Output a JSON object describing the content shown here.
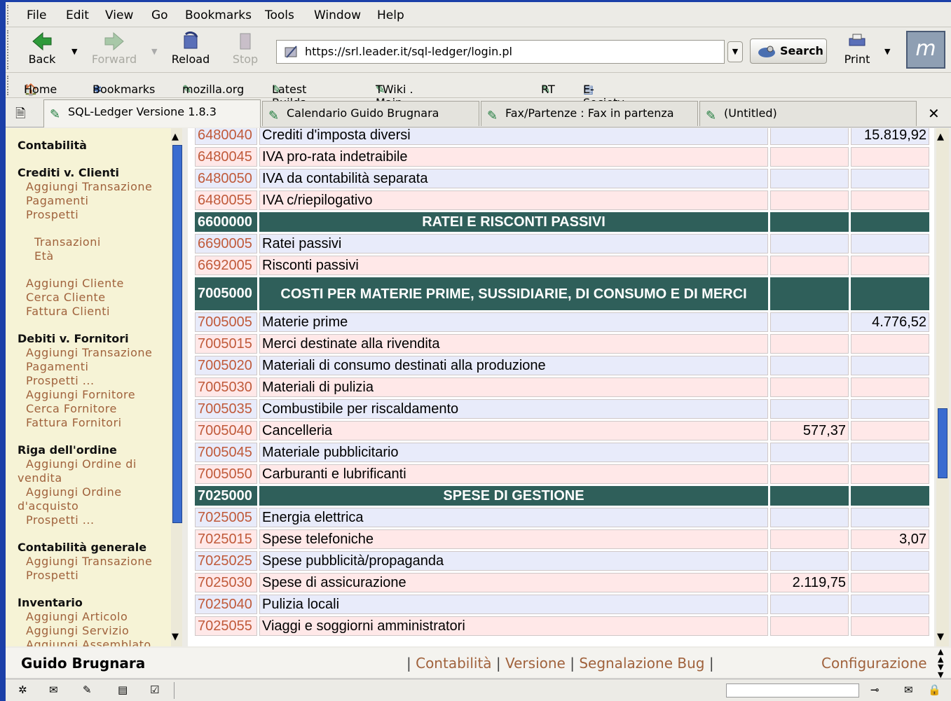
{
  "menu": [
    "File",
    "Edit",
    "View",
    "Go",
    "Bookmarks",
    "Tools",
    "Window",
    "Help"
  ],
  "nav": {
    "back": "Back",
    "forward": "Forward",
    "reload": "Reload",
    "stop": "Stop",
    "print": "Print",
    "search": "Search",
    "url": "https://srl.leader.it/sql-ledger/login.pl"
  },
  "bookmarks": [
    "Home",
    "Bookmarks",
    "mozilla.org",
    "Latest Builds",
    "TWiki . Main . WebHo...",
    "RT",
    "E-Society"
  ],
  "tabs": [
    "SQL-Ledger Versione 1.8.3",
    "Calendario Guido Brugnara",
    "Fax/Partenze : Fax in partenza",
    "(Untitled)"
  ],
  "sidebar": {
    "contabilita": "Contabilità",
    "crediti": {
      "title": "Crediti v. Clienti",
      "items": [
        "Aggiungi Transazione",
        "Pagamenti",
        "Prospetti"
      ],
      "sub": [
        "Transazioni",
        "Età"
      ],
      "more": [
        "Aggiungi Cliente",
        "Cerca Cliente",
        "Fattura Clienti"
      ]
    },
    "debiti": {
      "title": "Debiti v. Fornitori",
      "items": [
        "Aggiungi Transazione",
        "Pagamenti",
        "Prospetti ...",
        "Aggiungi Fornitore",
        "Cerca Fornitore",
        "Fattura Fornitori"
      ]
    },
    "ordine": {
      "title": "Riga dell'ordine",
      "items": [
        "Aggiungi Ordine di vendita",
        "Aggiungi Ordine d'acquisto",
        "Prospetti ..."
      ]
    },
    "generale": {
      "title": "Contabilità generale",
      "items": [
        "Aggiungi Transazione",
        "Prospetti"
      ]
    },
    "inventario": {
      "title": "Inventario",
      "items": [
        "Aggiungi Articolo",
        "Aggiungi Servizio",
        "Aggiungi Assemblato"
      ]
    }
  },
  "rows": [
    {
      "code": "6480040",
      "desc": "Crediti d'imposta diversi",
      "a": "",
      "b": "15.819,92",
      "type": "blue"
    },
    {
      "code": "6480045",
      "desc": "IVA pro-rata indetraibile",
      "a": "",
      "b": "",
      "type": "pink"
    },
    {
      "code": "6480050",
      "desc": "IVA da contabilità separata",
      "a": "",
      "b": "",
      "type": "blue"
    },
    {
      "code": "6480055",
      "desc": "IVA c/riepilogativo",
      "a": "",
      "b": "",
      "type": "pink"
    },
    {
      "code": "6600000",
      "desc": "RATEI E RISCONTI PASSIVI",
      "a": "",
      "b": "",
      "type": "head"
    },
    {
      "code": "6690005",
      "desc": "Ratei passivi",
      "a": "",
      "b": "",
      "type": "blue"
    },
    {
      "code": "6692005",
      "desc": "Risconti passivi",
      "a": "",
      "b": "",
      "type": "pink"
    },
    {
      "code": "7005000",
      "desc": "COSTI PER MATERIE PRIME, SUSSIDIARIE, DI CONSUMO E DI MERCI",
      "a": "",
      "b": "",
      "type": "head2"
    },
    {
      "code": "7005005",
      "desc": "Materie prime",
      "a": "",
      "b": "4.776,52",
      "type": "blue"
    },
    {
      "code": "7005015",
      "desc": "Merci destinate alla rivendita",
      "a": "",
      "b": "",
      "type": "pink"
    },
    {
      "code": "7005020",
      "desc": "Materiali di consumo destinati alla produzione",
      "a": "",
      "b": "",
      "type": "blue"
    },
    {
      "code": "7005030",
      "desc": "Materiali di pulizia",
      "a": "",
      "b": "",
      "type": "pink"
    },
    {
      "code": "7005035",
      "desc": "Combustibile per riscaldamento",
      "a": "",
      "b": "",
      "type": "blue"
    },
    {
      "code": "7005040",
      "desc": "Cancelleria",
      "a": "577,37",
      "b": "",
      "type": "pink"
    },
    {
      "code": "7005045",
      "desc": "Materiale pubblicitario",
      "a": "",
      "b": "",
      "type": "blue"
    },
    {
      "code": "7005050",
      "desc": "Carburanti e lubrificanti",
      "a": "",
      "b": "",
      "type": "pink"
    },
    {
      "code": "7025000",
      "desc": "SPESE DI GESTIONE",
      "a": "",
      "b": "",
      "type": "head"
    },
    {
      "code": "7025005",
      "desc": "Energia elettrica",
      "a": "",
      "b": "",
      "type": "blue"
    },
    {
      "code": "7025015",
      "desc": "Spese telefoniche",
      "a": "",
      "b": "3,07",
      "type": "pink"
    },
    {
      "code": "7025025",
      "desc": "Spese pubblicità/propaganda",
      "a": "",
      "b": "",
      "type": "blue"
    },
    {
      "code": "7025030",
      "desc": "Spese di assicurazione",
      "a": "2.119,75",
      "b": "",
      "type": "pink"
    },
    {
      "code": "7025040",
      "desc": "Pulizia locali",
      "a": "",
      "b": "",
      "type": "blue"
    },
    {
      "code": "7025055",
      "desc": "Viaggi e soggiorni amministratori",
      "a": "",
      "b": "",
      "type": "pink"
    }
  ],
  "footer": {
    "user": "Guido Brugnara",
    "links": [
      "Contabilità",
      "Versione",
      "Segnalazione Bug"
    ],
    "config": "Configurazione"
  }
}
